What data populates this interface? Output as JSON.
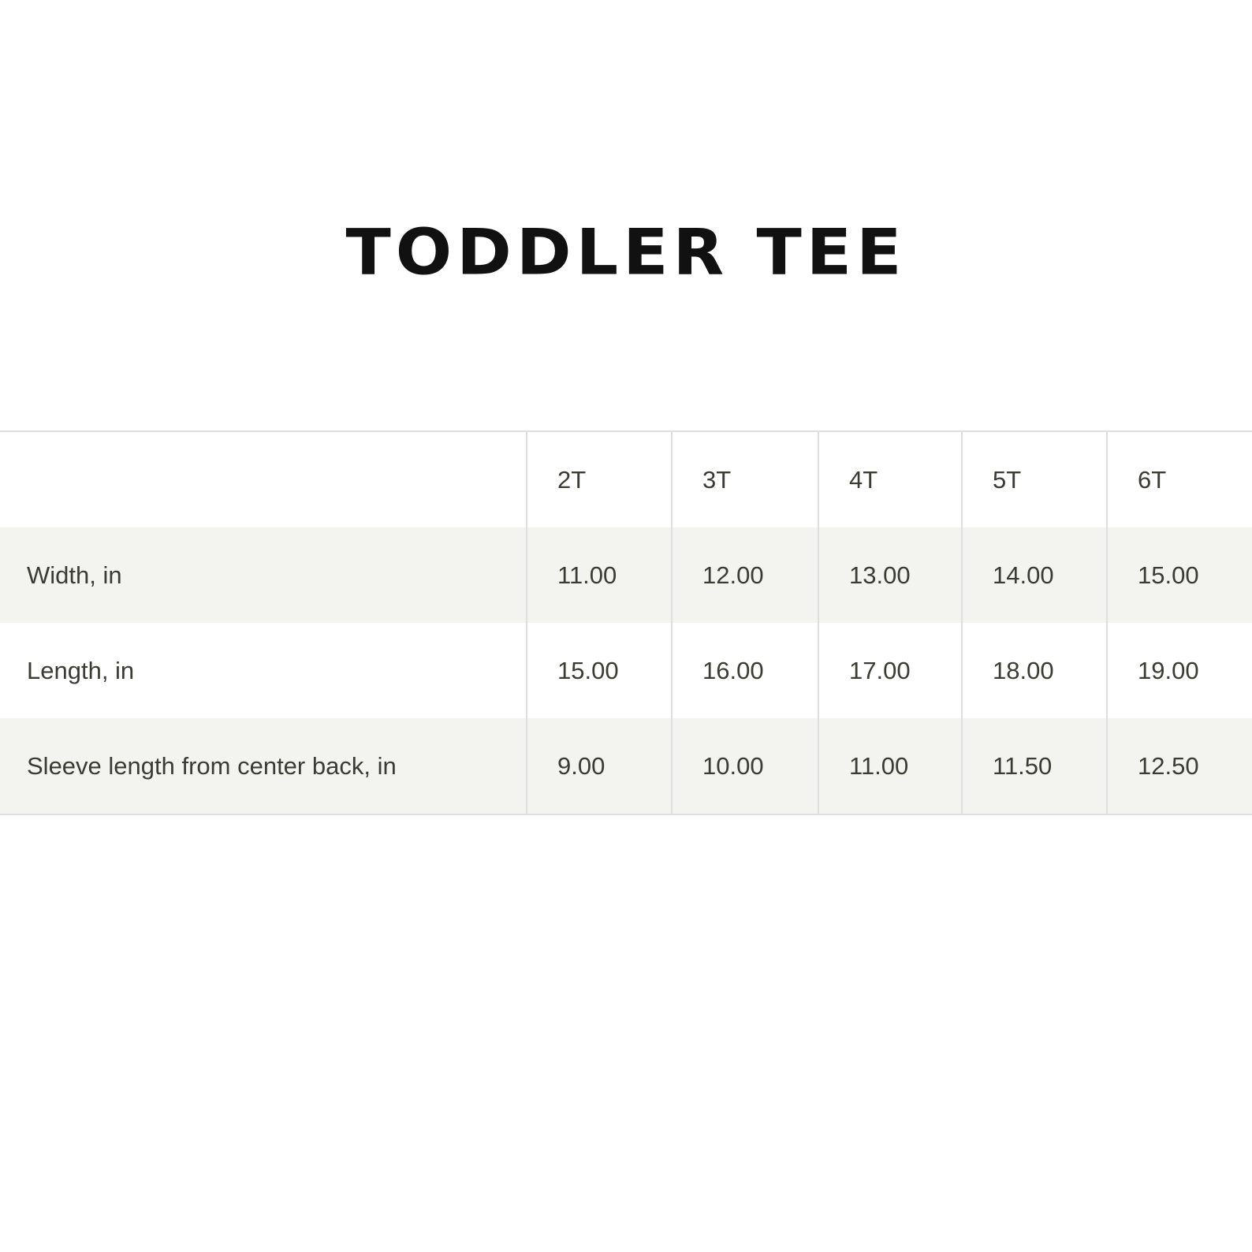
{
  "title": "TODDLER TEE",
  "table": {
    "header": [
      "",
      "2T",
      "3T",
      "4T",
      "5T",
      "6T"
    ],
    "rows": [
      {
        "label": "Width, in",
        "values": [
          "11.00",
          "12.00",
          "13.00",
          "14.00",
          "15.00"
        ]
      },
      {
        "label": "Length, in",
        "values": [
          "15.00",
          "16.00",
          "17.00",
          "18.00",
          "19.00"
        ]
      },
      {
        "label": "Sleeve length from center back, in",
        "values": [
          "9.00",
          "10.00",
          "11.00",
          "11.50",
          "12.50"
        ]
      }
    ]
  },
  "colors": {
    "row_shade": "#f3f3ef",
    "text": "#3a3c33",
    "grid": "#dedede",
    "title": "#111111"
  }
}
